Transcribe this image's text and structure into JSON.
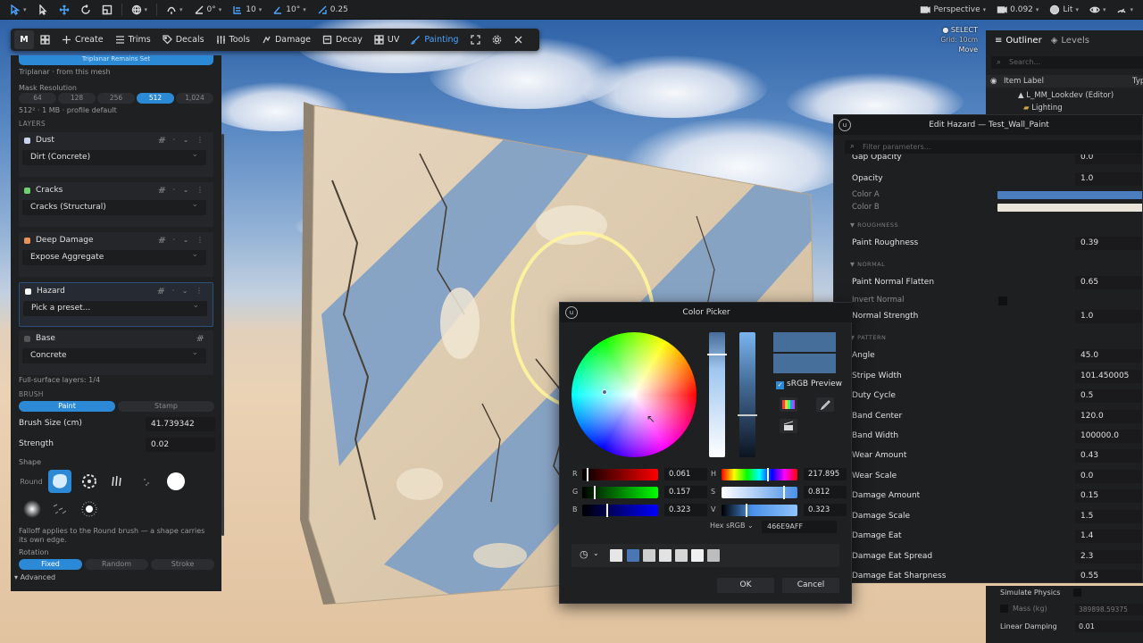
{
  "toolbar": {
    "snap_angle": "0°",
    "grid_size": "10",
    "rot_snap": "10°",
    "scale_snap": "0.25",
    "perspective": "Perspective",
    "camera_speed": "0.092",
    "lit": "Lit"
  },
  "modebar": {
    "logo": "M",
    "create": "Create",
    "trims": "Trims",
    "decals": "Decals",
    "tools": "Tools",
    "damage": "Damage",
    "decay": "Decay",
    "uv": "UV",
    "painting": "Painting"
  },
  "select_info": {
    "mode": "SELECT",
    "grid": "Grid: 10cm",
    "action": "Move"
  },
  "left_panel": {
    "top_button": "Triplanar Remains Set",
    "triplanar_note": "Triplanar · from this mesh",
    "mask_resolution_label": "Mask Resolution",
    "resolutions": [
      "64",
      "128",
      "256",
      "512",
      "1,024"
    ],
    "mask_info": "512² · 1 MB · profile default",
    "layers_label": "LAYERS",
    "layers": [
      {
        "name": "Dust",
        "preset": "Dirt (Concrete)",
        "color": "#c9d4ee"
      },
      {
        "name": "Cracks",
        "preset": "Cracks (Structural)",
        "color": "#6fcf71"
      },
      {
        "name": "Deep Damage",
        "preset": "Expose Aggregate",
        "color": "#e8935a"
      },
      {
        "name": "Hazard",
        "preset": "Pick a preset...",
        "color": "#ffffff"
      },
      {
        "name": "Base",
        "preset": "Concrete",
        "color": "#555555"
      }
    ],
    "full_surface": "Full-surface layers: 1/4",
    "brush_label": "BRUSH",
    "brush_modes": [
      "Paint",
      "Stamp"
    ],
    "brush_size_label": "Brush Size (cm)",
    "brush_size_value": "41.739342",
    "strength_label": "Strength",
    "strength_value": "0.02",
    "shape_label": "Shape",
    "shape_round": "Round",
    "falloff_note": "Falloff applies to the Round brush — a shape carries its own edge.",
    "rotation_label": "Rotation",
    "rotation_modes": [
      "Fixed",
      "Random",
      "Stroke"
    ],
    "advanced_label": "Advanced"
  },
  "outliner": {
    "tab_outliner": "Outliner",
    "tab_levels": "Levels",
    "search_placeholder": "Search...",
    "col_label": "Item Label",
    "col_type": "Typ",
    "row_level": "L_MM_Lookdev (Editor)",
    "row_folder": "Lighting"
  },
  "hazard": {
    "title": "Edit Hazard — Test_Wall_Paint",
    "filter_placeholder": "Filter parameters...",
    "gap_opacity_label": "Gap Opacity",
    "gap_opacity_value": "0.0",
    "opacity_label": "Opacity",
    "opacity_value": "1.0",
    "color_a_label": "Color A",
    "color_a": "#4a7ebf",
    "color_b_label": "Color B",
    "color_b": "#e8e4da",
    "sec_roughness": "ROUGHNESS",
    "paint_roughness_label": "Paint Roughness",
    "paint_roughness_value": "0.39",
    "sec_normal": "NORMAL",
    "normal_flatten_label": "Paint Normal Flatten",
    "normal_flatten_value": "0.65",
    "invert_normal_label": "Invert Normal",
    "normal_strength_label": "Normal Strength",
    "normal_strength_value": "1.0",
    "sec_pattern": "PATTERN",
    "params": [
      {
        "label": "Angle",
        "value": "45.0"
      },
      {
        "label": "Stripe Width",
        "value": "101.450005"
      },
      {
        "label": "Duty Cycle",
        "value": "0.5"
      },
      {
        "label": "Band Center",
        "value": "120.0"
      },
      {
        "label": "Band Width",
        "value": "100000.0"
      },
      {
        "label": "Wear Amount",
        "value": "0.43"
      },
      {
        "label": "Wear Scale",
        "value": "0.0"
      },
      {
        "label": "Damage Amount",
        "value": "0.15"
      },
      {
        "label": "Damage Scale",
        "value": "1.5"
      },
      {
        "label": "Damage Eat",
        "value": "1.4"
      },
      {
        "label": "Damage Eat Spread",
        "value": "2.3"
      },
      {
        "label": "Damage Eat Sharpness",
        "value": "0.55"
      }
    ]
  },
  "physics": {
    "simulate_label": "Simulate Physics",
    "mass_label": "Mass (kg)",
    "mass_value": "389898.59375",
    "linear_damping_label": "Linear Damping",
    "linear_damping_value": "0.01"
  },
  "picker": {
    "title": "Color Picker",
    "srgb_label": "sRGB Preview",
    "r_label": "R",
    "r_value": "0.061",
    "g_label": "G",
    "g_value": "0.157",
    "b_label": "B",
    "b_value": "0.323",
    "h_label": "H",
    "h_value": "217.895",
    "s_label": "S",
    "s_value": "0.812",
    "v_label": "V",
    "v_value": "0.323",
    "hex_label": "Hex sRGB",
    "hex_value": "466E9AFF",
    "ok": "OK",
    "cancel": "Cancel",
    "current_color": "#466e9a",
    "recent_colors": [
      "#e6e6e6",
      "#4a77b4",
      "#cfcfcf",
      "#e3e3e3",
      "#d6d6d6",
      "#f0f0f0",
      "#bdbdbd"
    ]
  }
}
